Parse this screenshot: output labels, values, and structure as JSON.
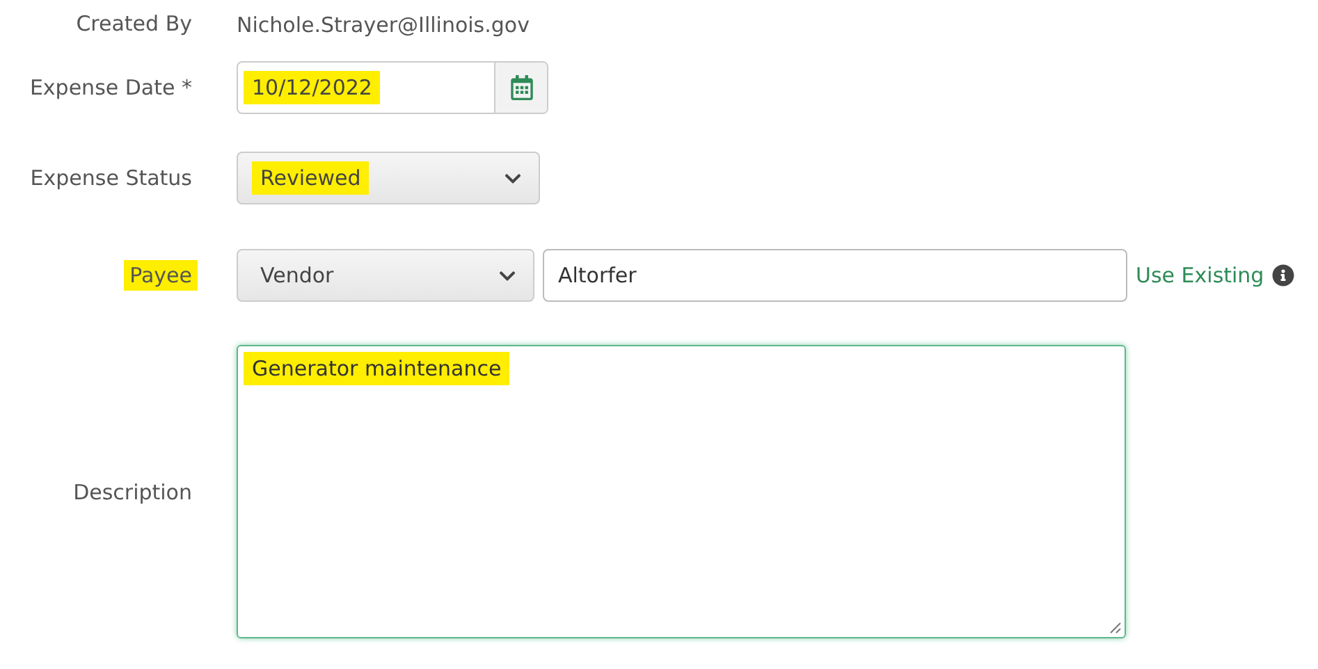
{
  "created_by": {
    "label": "Created By",
    "value": "Nichole.Strayer@Illinois.gov",
    "highlighted": false
  },
  "expense_date": {
    "label": "Expense Date *",
    "value": "10/12/2022",
    "highlighted": true,
    "label_highlighted": false
  },
  "expense_status": {
    "label": "Expense Status",
    "value": "Reviewed",
    "highlighted": true,
    "label_highlighted": false
  },
  "payee": {
    "label": "Payee",
    "label_highlighted": true,
    "type": "Vendor",
    "value": "Altorfer",
    "link": "Use Existing"
  },
  "description": {
    "label": "Description",
    "value": "Generator maintenance",
    "highlighted": true,
    "focused": true
  }
}
